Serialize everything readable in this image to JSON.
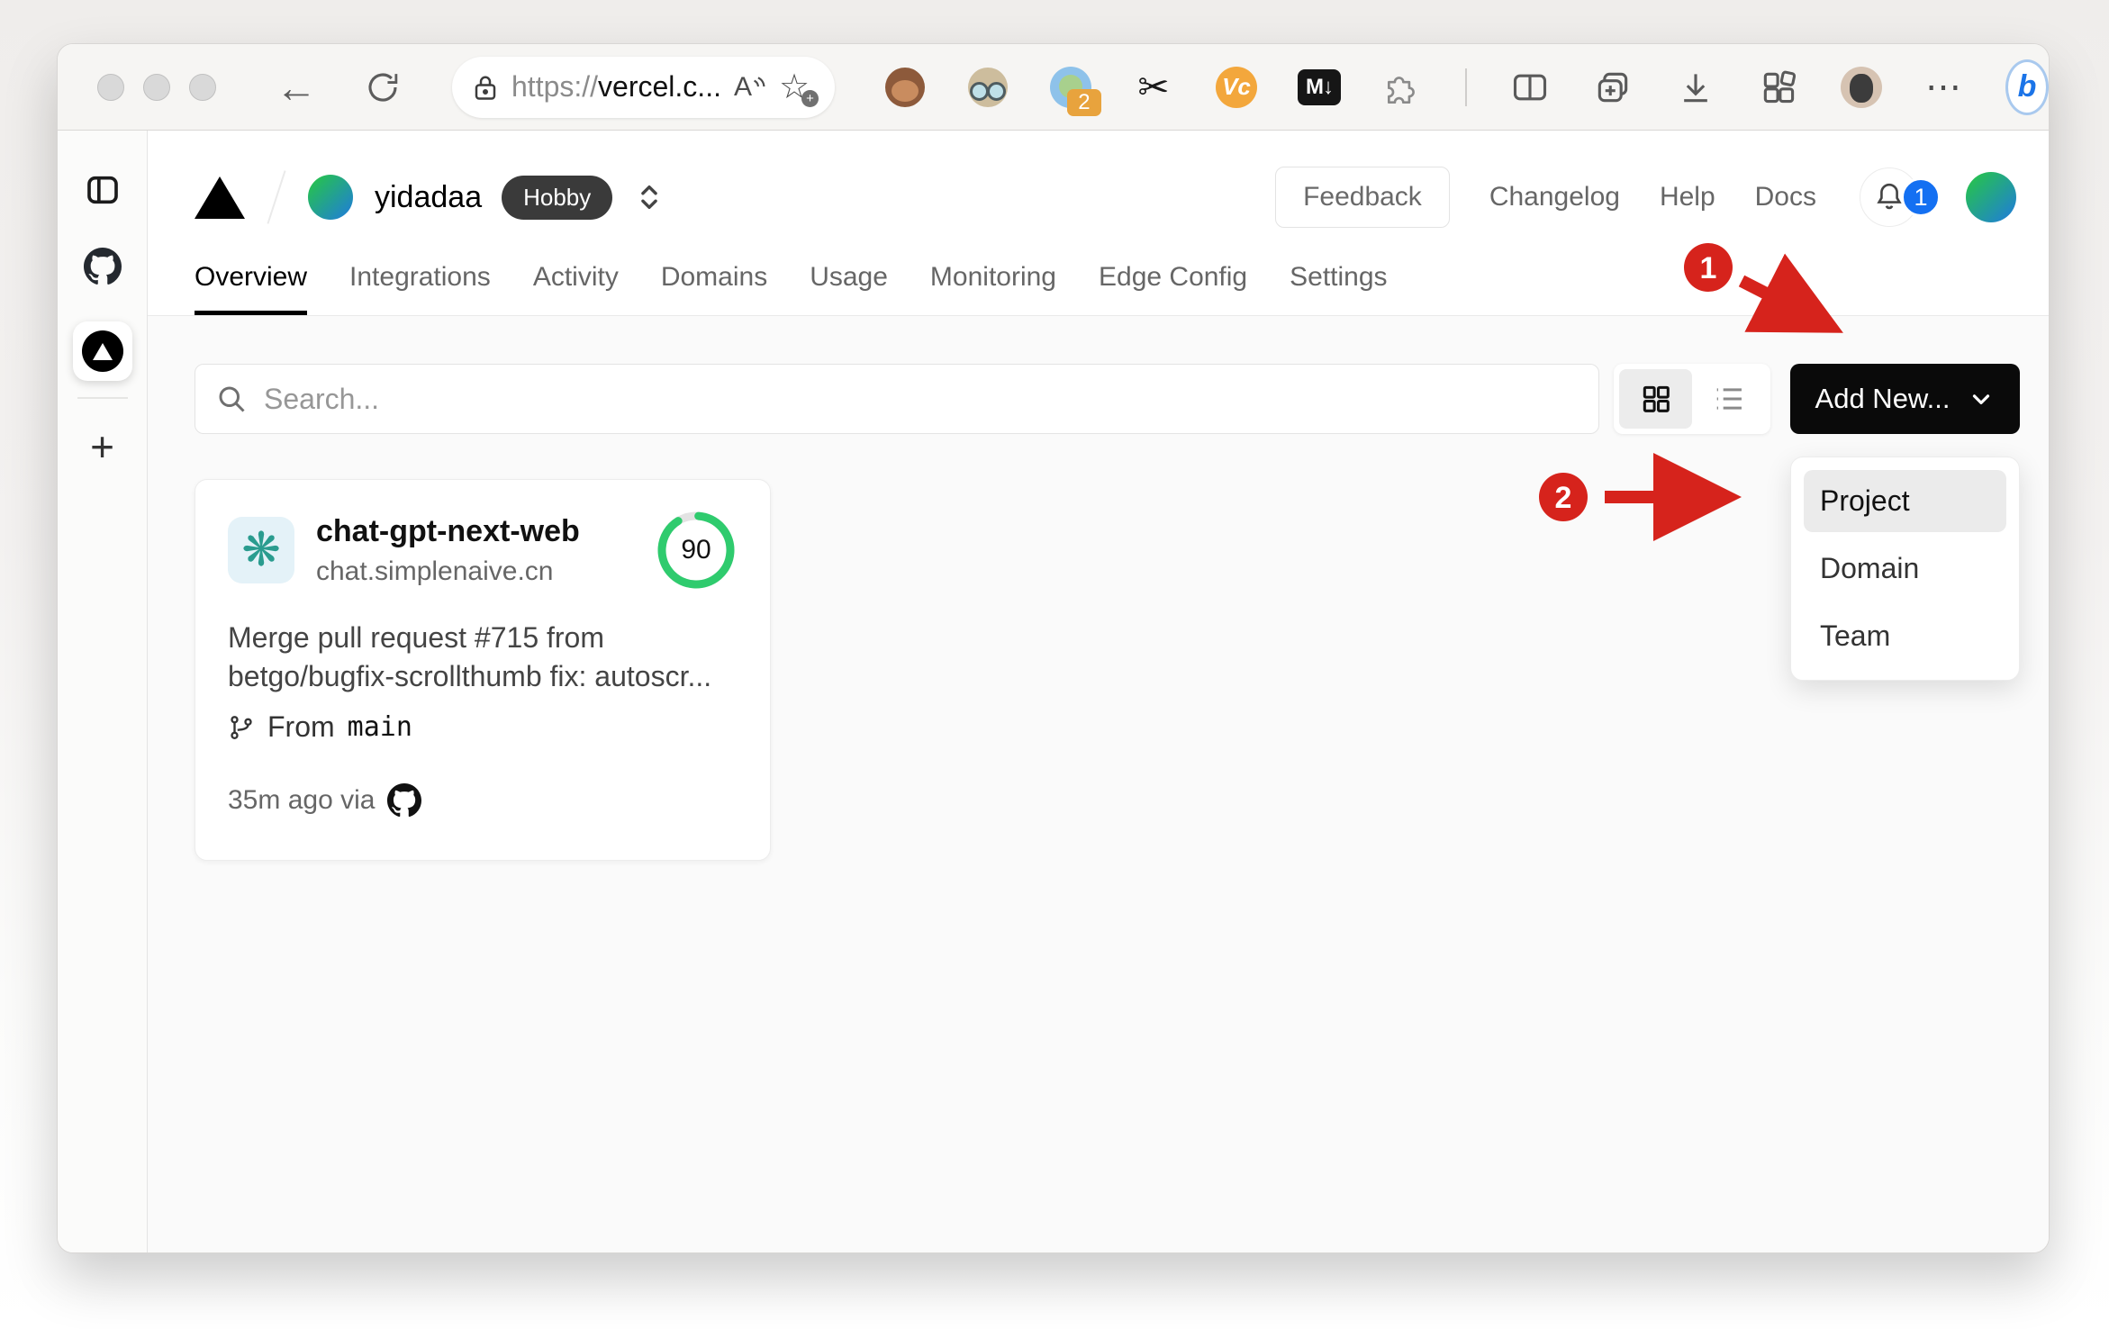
{
  "colors": {
    "annotation_red": "#d6231c",
    "button_black": "#0a0a0a",
    "score_green": "#2fcb6e",
    "openai_teal": "#2a9c8f",
    "openai_bg": "#e4f2f8",
    "badge_blue": "#1470f2",
    "hobby_bg": "#3a3a3a"
  },
  "browser": {
    "address": {
      "scheme": "https://",
      "host": "vercel.c...",
      "reader_label": "A"
    },
    "glyphs": {
      "back": "←",
      "scissors": "✂",
      "star": "☆",
      "more": "⋯",
      "new_tab_plus": "+",
      "bing": "b"
    },
    "extensions": {
      "counter_badge": "2",
      "vc_label": "Vc",
      "markdown_label": "M↓"
    }
  },
  "site": {
    "team": {
      "name": "yidadaa",
      "plan": "Hobby"
    },
    "actions": {
      "feedback": "Feedback",
      "links": [
        "Changelog",
        "Help",
        "Docs"
      ],
      "notifications": "1"
    },
    "tabs": [
      {
        "label": "Overview"
      },
      {
        "label": "Integrations"
      },
      {
        "label": "Activity"
      },
      {
        "label": "Domains"
      },
      {
        "label": "Usage"
      },
      {
        "label": "Monitoring"
      },
      {
        "label": "Edge Config"
      },
      {
        "label": "Settings"
      }
    ],
    "toolbar": {
      "search_placeholder": "Search...",
      "add_new": "Add New..."
    },
    "dropdown": {
      "items": [
        {
          "label": "Project"
        },
        {
          "label": "Domain"
        },
        {
          "label": "Team"
        }
      ]
    },
    "project_card": {
      "name": "chat-gpt-next-web",
      "domain": "chat.simplenaive.cn",
      "score": "90",
      "commit_line1": "Merge pull request #715 from",
      "commit_line2": "betgo/bugfix-scrollthumb fix: autoscr...",
      "branch_label": "From",
      "branch_name": "main",
      "deployed_meta": "35m ago via"
    }
  },
  "annotations": {
    "step1": "1",
    "step2": "2"
  }
}
